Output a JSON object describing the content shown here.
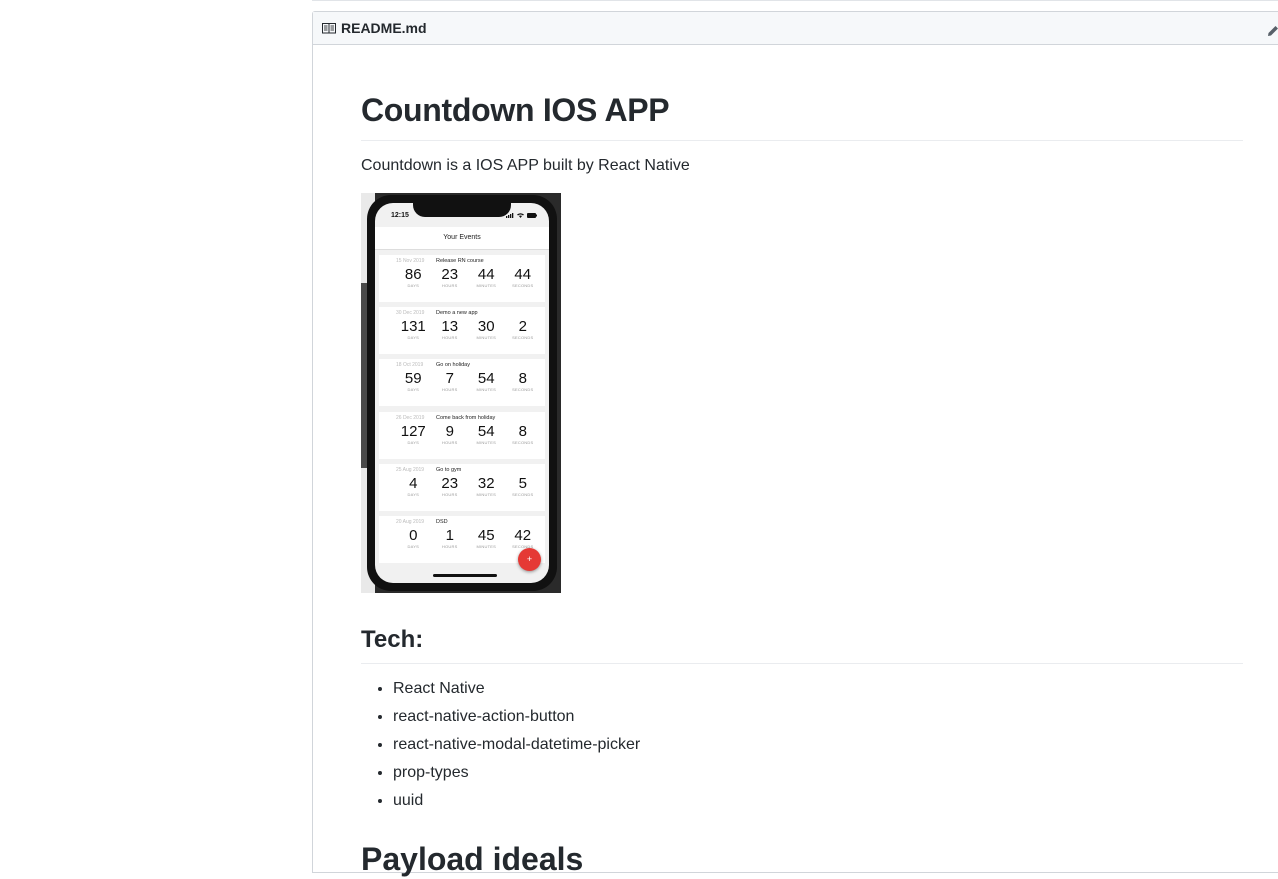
{
  "readme": {
    "filename": "README.md",
    "title": "Countdown IOS APP",
    "intro": "Countdown is a IOS APP built by React Native",
    "tech_heading": "Tech:",
    "tech_items": [
      "React Native",
      "react-native-action-button",
      "react-native-modal-datetime-picker",
      "prop-types",
      "uuid"
    ],
    "next_heading": "Payload ideals"
  },
  "app_screenshot": {
    "status_time": "12:15",
    "nav_title": "Your Events",
    "units": [
      "DAYS",
      "HOURS",
      "MINUTES",
      "SECONDS"
    ],
    "fab_label": "+",
    "events": [
      {
        "date": "15 Nov 2019",
        "title": "Release RN course",
        "values": [
          "86",
          "23",
          "44",
          "44"
        ]
      },
      {
        "date": "30 Dec 2019",
        "title": "Demo a new app",
        "values": [
          "131",
          "13",
          "30",
          "2"
        ]
      },
      {
        "date": "18 Oct 2019",
        "title": "Go on holiday",
        "values": [
          "59",
          "7",
          "54",
          "8"
        ]
      },
      {
        "date": "26 Dec 2019",
        "title": "Come back from holiday",
        "values": [
          "127",
          "9",
          "54",
          "8"
        ]
      },
      {
        "date": "25 Aug 2019",
        "title": "Go to gym",
        "values": [
          "4",
          "23",
          "32",
          "5"
        ]
      },
      {
        "date": "20 Aug 2019",
        "title": "DSD",
        "values": [
          "0",
          "1",
          "45",
          "42"
        ]
      }
    ]
  },
  "icons": {
    "header": "book-icon",
    "edit": "pencil-icon"
  }
}
